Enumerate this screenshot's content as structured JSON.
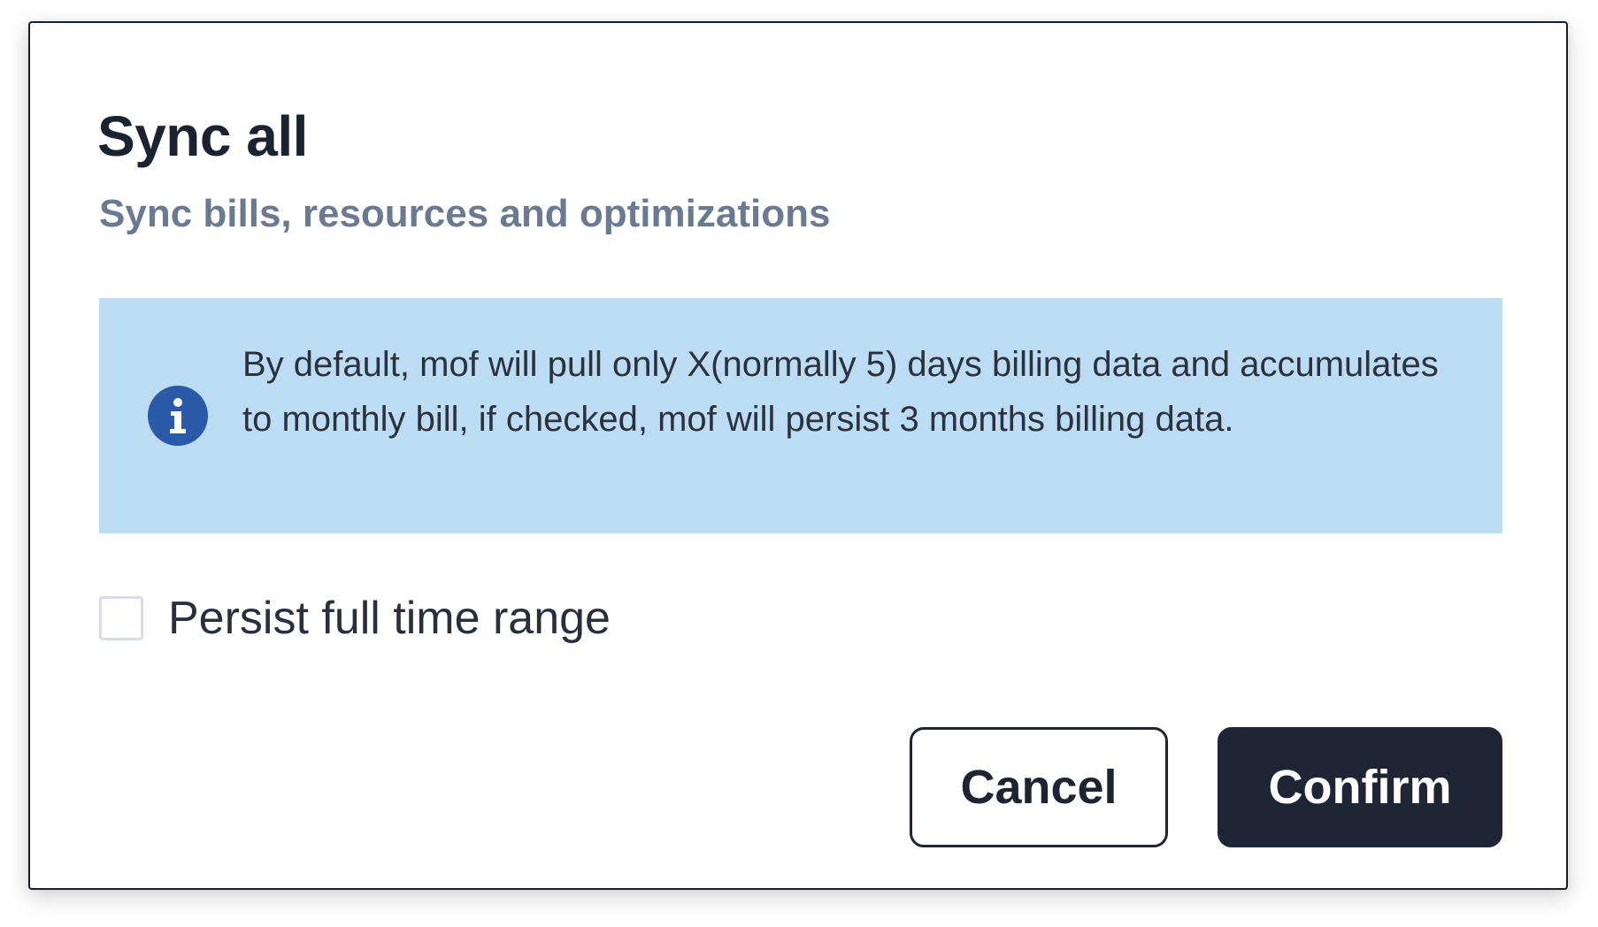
{
  "dialog": {
    "title": "Sync all",
    "subtitle": "Sync bills, resources and optimizations",
    "info": {
      "icon": "info-icon",
      "text": "By default, mof will pull only X(normally 5) days billing data and accumulates to monthly bill, if checked, mof will persist 3 months billing data."
    },
    "checkbox": {
      "label": "Persist full time range",
      "checked": false
    },
    "buttons": {
      "cancel_label": "Cancel",
      "confirm_label": "Confirm"
    }
  },
  "colors": {
    "title": "#1c2230",
    "subtitle": "#6b7a93",
    "info_background": "#bcdcf4",
    "info_icon": "#2a5aa8",
    "confirm_background": "#1f2535"
  }
}
